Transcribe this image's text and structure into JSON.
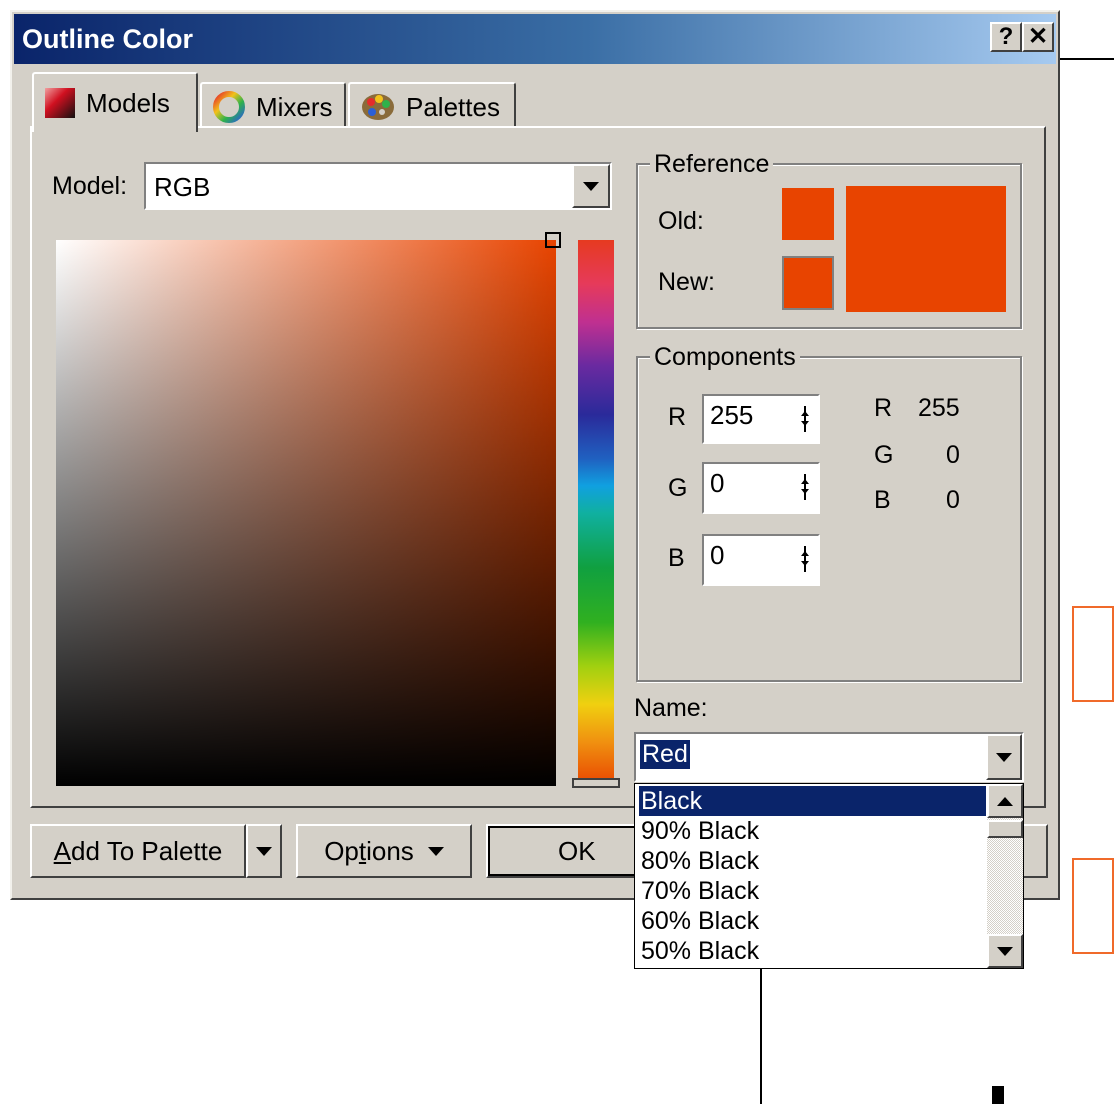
{
  "dialog": {
    "title": "Outline Color",
    "help_glyph": "?",
    "close_glyph": "✕"
  },
  "tabs": [
    {
      "label": "Models",
      "icon": "color-model-icon",
      "active": true
    },
    {
      "label": "Mixers",
      "icon": "color-wheel-icon",
      "active": false
    },
    {
      "label": "Palettes",
      "icon": "palette-icon",
      "active": false
    }
  ],
  "model": {
    "label": "Model:",
    "value": "RGB"
  },
  "reference": {
    "legend": "Reference",
    "old_label": "Old:",
    "new_label": "New:",
    "old_color": "#e84400",
    "new_color": "#e84400"
  },
  "components": {
    "legend": "Components",
    "inputs": [
      {
        "label": "R",
        "value": "255"
      },
      {
        "label": "G",
        "value": "0"
      },
      {
        "label": "B",
        "value": "0"
      }
    ],
    "readout": [
      {
        "label": "R",
        "value": "255"
      },
      {
        "label": "G",
        "value": "0"
      },
      {
        "label": "B",
        "value": "0"
      }
    ]
  },
  "name": {
    "label": "Name:",
    "value": "Red",
    "options": [
      "Black",
      "90% Black",
      "80% Black",
      "70% Black",
      "60% Black",
      "50% Black"
    ],
    "selected": "Black"
  },
  "buttons": {
    "add_to_palette_prefix": "A",
    "add_to_palette_rest": "dd To Palette",
    "options_prefix": "Op",
    "options_underlined": "t",
    "options_rest": "ions",
    "ok": "OK"
  },
  "colors": {
    "accent": "#e84400",
    "dialog_bg": "#d4d0c8",
    "title_start": "#0a246a",
    "selection": "#0a246a"
  }
}
